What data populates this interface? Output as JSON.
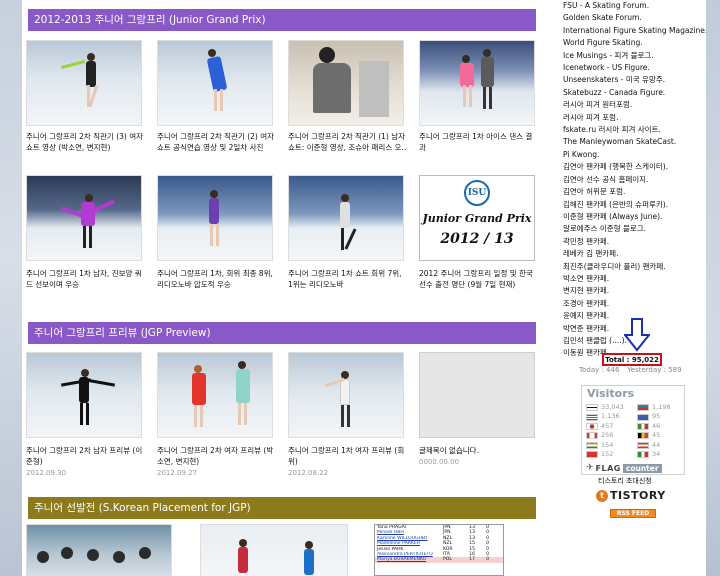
{
  "sections": [
    {
      "title": "2012-2013 주니어 그랑프리 (Junior Grand Prix)",
      "posts": [
        {
          "caption": "주니어 그랑프리 2차 직관기 (3) 여자 쇼트 영상 (박소연, 변지현)",
          "date": ""
        },
        {
          "caption": "주니어 그랑프리 2차 직관기 (2) 여자 쇼트 공식연습 영상 및 2일차 사진",
          "date": ""
        },
        {
          "caption": "주니어 그랑프리 2차 직관기 (1) 남자쇼트: 이준형 영상, 조슈아 패리스 오..",
          "date": ""
        },
        {
          "caption": "주니어 그랑프리 1차 아이스 댄스 결과",
          "date": ""
        },
        {
          "caption": "주니어 그랑프리 1차 남자, 진보양 쿼드 선보이며 우승",
          "date": ""
        },
        {
          "caption": "주니어 그랑프리 1차, 회위 최종 8위, 리디오노바 압도적 우승",
          "date": ""
        },
        {
          "caption": "주니어 그랑프리 1차 쇼트 회위 7위, 1위는 리디오노바",
          "date": ""
        },
        {
          "caption": "2012 주니어 그랑프리 일정 및 한국선수 출전 명단 (9월 7일 현재)",
          "date": ""
        }
      ]
    },
    {
      "title": "주니어 그랑프리 프리뷰 (JGP Preview)",
      "posts": [
        {
          "caption": "주니어 그랑프리 2차 남자 프리뷰 (이준형)",
          "date": "2012.09.30"
        },
        {
          "caption": "주니어 그랑프리 2차 여자 프리뷰 (박소연, 변지현)",
          "date": "2012.09.27"
        },
        {
          "caption": "주니어 그랑프리 1차 여자 프리뷰 (회위)",
          "date": "2012.08.22"
        },
        {
          "caption": "글제목이 없습니다.",
          "date": "0000.00.00"
        }
      ]
    },
    {
      "title": "주니어 선발전 (S.Korean Placement for JGP)"
    }
  ],
  "jgp_card": {
    "logo": "ISU",
    "title": "Junior Grand Prix",
    "year": "2012 / 13"
  },
  "ranking_table": [
    {
      "name": "Yana PRAGAI",
      "country": "JPN",
      "pts": "13",
      "q": "0"
    },
    {
      "name": "Minodi OBH",
      "country": "JPN",
      "pts": "13",
      "q": "0"
    },
    {
      "name": "Karoline WILLOUGHBY",
      "country": "NZL",
      "pts": "13",
      "q": "0"
    },
    {
      "name": "Madeleine PARKER",
      "country": "NZL",
      "pts": "15",
      "q": "0"
    },
    {
      "name": "Jessie PARK",
      "country": "KOR",
      "pts": "15",
      "q": "0"
    },
    {
      "name": "Aleksandra PERTICHETO",
      "country": "ITA",
      "pts": "16",
      "q": "0"
    },
    {
      "name": "Mariya BURAKMENKO",
      "country": "POL",
      "pts": "17",
      "q": "0"
    }
  ],
  "sidebar": {
    "links": [
      "FSU - A Skating Forum.",
      "Golden Skate Forum.",
      "International Figure Skating Magazine.",
      "World Figure Skating.",
      "Ice Musings - 피겨 블로그.",
      "Icenetwork - US Figure.",
      "Unseenskaters - 미국 유망주.",
      "Skatebuzz - Canada Figure.",
      "러시아 피겨 원터포럼.",
      "러시아 피겨 포럼.",
      "fskate.ru 러시아 피겨 사이트.",
      "The Manleywoman SkateCast.",
      "Pi Kwong.",
      "김연아 팬카페 (행복한 스케이터).",
      "김연아 선수 공식 홈페이지.",
      "김연아 허위문 포럼.",
      "김해진 팬카페 (은반의 슈퍼루키).",
      "이준형 팬카페 (Always June).",
      "알로에주스 이준형 블로그.",
      "곽민정 팬카페.",
      "레베카 김 팬카페.",
      "최진주(클라우디아 플러) 팬카페.",
      "박소연 팬카페.",
      "변지현 팬카페.",
      "조경아 팬카페.",
      "윤예지 팬카페.",
      "박연준 팬카페.",
      "김민석 팬클럽 (....).",
      "이동원 팬카페."
    ],
    "counter": {
      "total": "Total : 95,022",
      "today": "Today : 446",
      "yesterday": "Yesterday : 589"
    },
    "visitors": {
      "title": "Visitors",
      "rows": [
        {
          "flag_color": "#1a1a1a",
          "value": "33,043"
        },
        {
          "flag_color": "#4b6cb7",
          "value": "1,198"
        },
        {
          "flag_color": "#bf3b3b",
          "value": "1,136"
        },
        {
          "flag_color": "#3b5bb0",
          "value": "95"
        },
        {
          "flag_color": "#e8e8e8",
          "value": "457"
        },
        {
          "flag_color": "#3b8a3b",
          "value": "46"
        },
        {
          "flag_color": "#d93b3b",
          "value": "256"
        },
        {
          "flag_color": "#000000",
          "value": "45"
        },
        {
          "flag_color": "#d87f2b",
          "value": "154"
        },
        {
          "flag_color": "#c83b2b",
          "value": "44"
        },
        {
          "flag_color": "#d8312b",
          "value": "152"
        },
        {
          "flag_color": "#2f8a3a",
          "value": "34"
        }
      ],
      "flag_word": "FLAG",
      "counter_word": "counter"
    },
    "tistory_invite": "티스토리 초대신청",
    "tistory_logo": "TISTORY",
    "rss": "RSS FEED"
  },
  "colors": {
    "header_purple": "#8a59c8",
    "header_olive": "#8c7a1c",
    "counter_red": "#c0141a",
    "arrow_blue": "#1b2fb0"
  }
}
